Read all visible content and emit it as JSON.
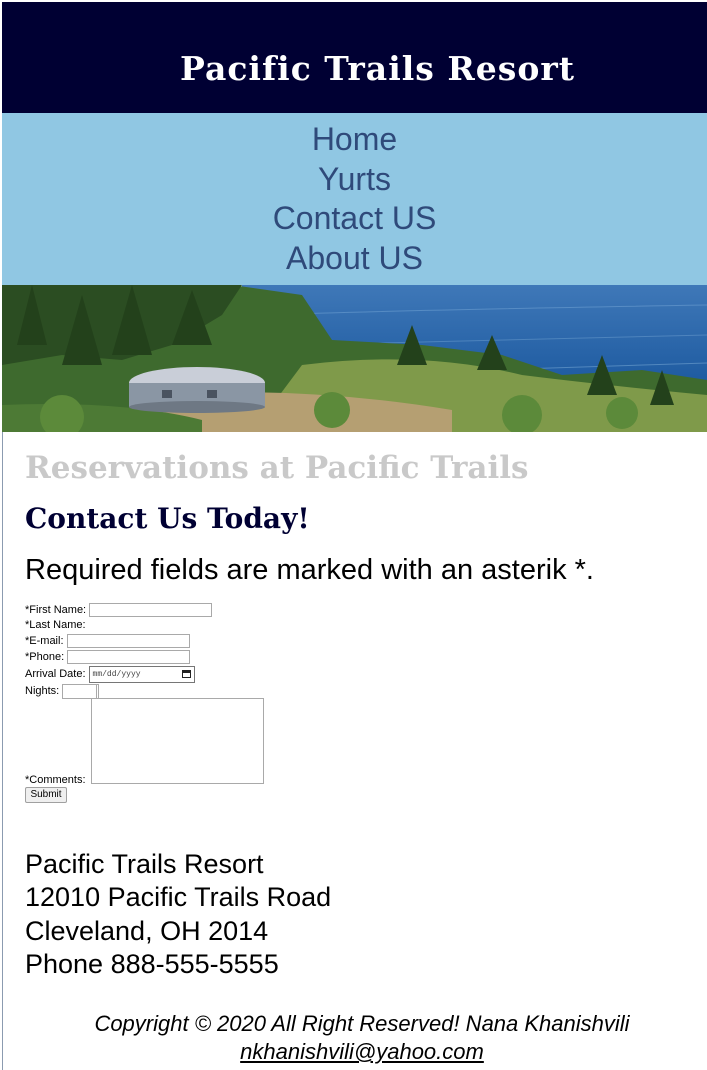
{
  "header": {
    "site_title": "Pacific Trails Resort"
  },
  "nav": {
    "items": [
      "Home",
      "Yurts",
      "Contact US",
      "About US"
    ]
  },
  "hero": {
    "alt": "Yurt among trees overlooking the Pacific Ocean"
  },
  "main": {
    "heading": "Reservations at Pacific Trails",
    "subheading": "Contact Us Today!",
    "required_note": "Required fields are marked with an asterik *."
  },
  "form": {
    "first_name_label": "*First Name:",
    "last_name_label": "*Last Name:",
    "email_label": "*E-mail:",
    "phone_label": "*Phone:",
    "arrival_label": "Arrival Date:",
    "arrival_placeholder": "mm/dd/yyyy",
    "nights_label": "Nights:",
    "comments_label": "*Comments:",
    "submit_label": "Submit"
  },
  "address": {
    "name": "Pacific Trails Resort",
    "street": "12010 Pacific Trails Road",
    "city": "Cleveland, OH 2014",
    "phone": "Phone 888-555-5555"
  },
  "footer": {
    "copyright": "Copyright © 2020 All Right Reserved! Nana Khanishvili",
    "email": "nkhanishvili@yahoo.com"
  },
  "colors": {
    "header_bg": "#000033",
    "nav_bg": "#90c7e3",
    "nav_link": "#2f4a7a",
    "heading_gray": "#c9c9c9",
    "heading_navy": "#000033"
  }
}
